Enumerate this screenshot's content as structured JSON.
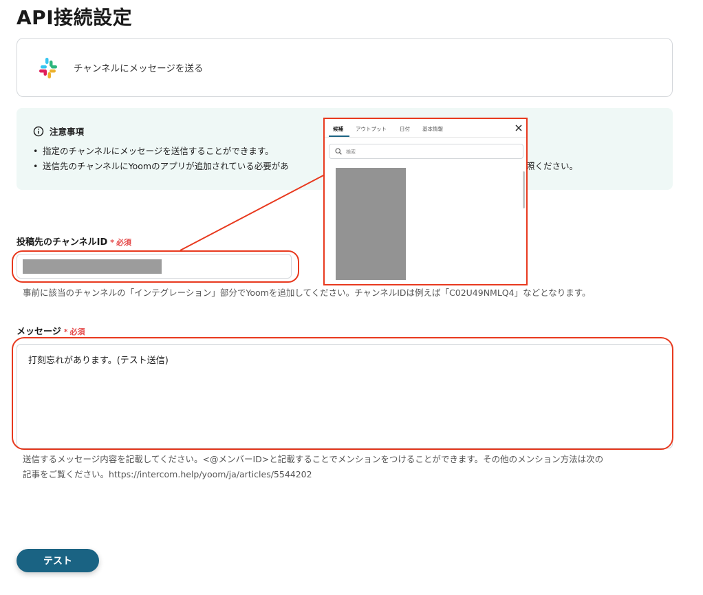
{
  "page": {
    "title": "API接続設定"
  },
  "app_card": {
    "app_icon": "slack-icon",
    "action_label": "チャンネルにメッセージを送る"
  },
  "notice": {
    "title": "注意事項",
    "items": [
      "指定のチャンネルにメッセージを送信することができます。",
      "送信先のチャンネルにYoomのアプリが追加されている必要があ"
    ],
    "trailing_text": "照ください。"
  },
  "channel_field": {
    "label": "投稿先のチャンネルID",
    "required_star": "*",
    "required_label": "必須",
    "help": "事前に該当のチャンネルの「インテグレーション」部分でYoomを追加してください。チャンネルIDは例えば「C02U49NMLQ4」などとなります。"
  },
  "message_field": {
    "label": "メッセージ",
    "required_star": "*",
    "required_label": "必須",
    "value": "打刻忘れがあります。(テスト送信)",
    "help_line1": "送信するメッセージ内容を記載してください。<@メンバーID>と記載することでメンションをつけることができます。その他のメンション方法は次の",
    "help_line2": "記事をご覧ください。https://intercom.help/yoom/ja/articles/5544202"
  },
  "popup": {
    "tabs": [
      "候補",
      "アウトプット",
      "日付",
      "基本情報"
    ],
    "active_tab": "候補",
    "search_placeholder": "検索"
  },
  "actions": {
    "test_label": "テスト"
  },
  "colors": {
    "highlight": "#e8391e",
    "primary": "#1a6383",
    "required": "#e54b4b",
    "notice_bg": "#eff8f6"
  }
}
